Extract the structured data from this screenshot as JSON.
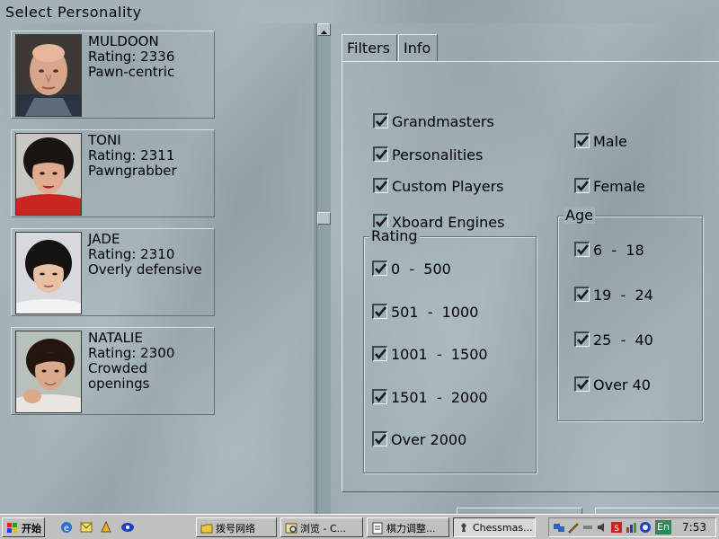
{
  "window": {
    "title": "Select Personality"
  },
  "personalities": [
    {
      "name": "MULDOON",
      "rating": "Rating: 2336",
      "style_lines": [
        "Pawn-centric"
      ]
    },
    {
      "name": "TONI",
      "rating": "Rating: 2311",
      "style_lines": [
        "Pawngrabber"
      ]
    },
    {
      "name": "JADE",
      "rating": "Rating: 2310",
      "style_lines": [
        "Overly defensive"
      ]
    },
    {
      "name": "NATALIE",
      "rating": "Rating: 2300",
      "style_lines": [
        "Crowded",
        "openings"
      ]
    }
  ],
  "tabs": [
    {
      "label": "Filters",
      "active": true
    },
    {
      "label": "Info",
      "active": false
    }
  ],
  "filters": {
    "types": [
      {
        "label": "Grandmasters",
        "checked": true
      },
      {
        "label": "Personalities",
        "checked": true
      },
      {
        "label": "Custom Players",
        "checked": true
      },
      {
        "label": "Xboard Engines",
        "checked": true
      }
    ],
    "gender": [
      {
        "label": "Male",
        "checked": true
      },
      {
        "label": "Female",
        "checked": true
      }
    ],
    "rating_group_label": "Rating",
    "rating": [
      {
        "label": "0  -  500",
        "checked": true
      },
      {
        "label": "501  -  1000",
        "checked": true
      },
      {
        "label": "1001  -  1500",
        "checked": true
      },
      {
        "label": "1501  -  2000",
        "checked": true
      },
      {
        "label": "Over 2000",
        "checked": true
      }
    ],
    "age_group_label": "Age",
    "age": [
      {
        "label": "6  -  18",
        "checked": true
      },
      {
        "label": "19  -  24",
        "checked": true
      },
      {
        "label": "25  -  40",
        "checked": true
      },
      {
        "label": "Over 40",
        "checked": true
      }
    ]
  },
  "taskbar": {
    "start_label": "开始",
    "quick_launch_icons": [
      "ie-icon",
      "outlook-icon",
      "winamp-icon",
      "media-icon"
    ],
    "tasks": [
      {
        "label": "拨号网络",
        "icon": "folder-icon",
        "active": false
      },
      {
        "label": "浏览 - C...",
        "icon": "explorer-icon",
        "active": false
      },
      {
        "label": "棋力调整...",
        "icon": "document-icon",
        "active": false
      },
      {
        "label": "Chessmas...",
        "icon": "chess-icon",
        "active": true
      }
    ],
    "tray": {
      "language": "En",
      "clock": "7:53"
    }
  },
  "colors": {
    "background": "#9fb0b6",
    "check_mark": "#1a1a1a",
    "taskbar": "#c0c0c0"
  }
}
